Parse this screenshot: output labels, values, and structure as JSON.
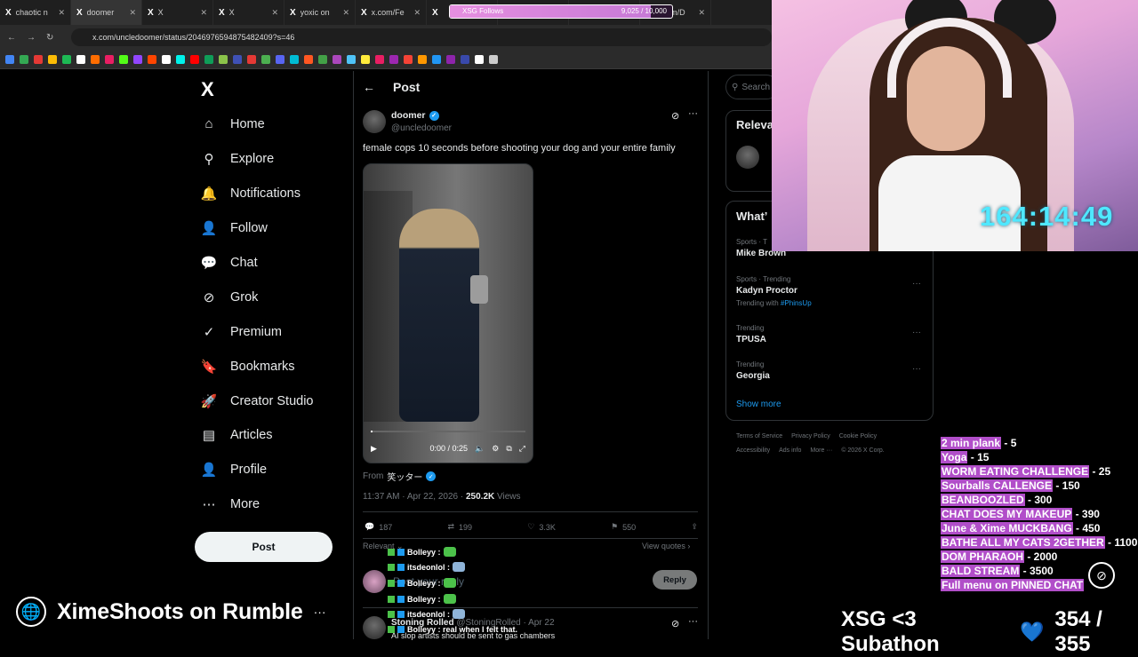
{
  "browser": {
    "tabs": [
      {
        "label": "chaotic n",
        "active": false
      },
      {
        "label": "doomer",
        "active": true
      },
      {
        "label": "X",
        "active": false
      },
      {
        "label": "X",
        "active": false
      },
      {
        "label": "yoxic on",
        "active": false
      },
      {
        "label": "x.com/Fe",
        "active": false
      },
      {
        "label": "",
        "active": false
      },
      {
        "label": "",
        "active": false
      },
      {
        "label": "",
        "active": false
      },
      {
        "label": "x.com/D",
        "active": false
      }
    ],
    "url": "x.com/uncledoomer/status/2046976594875482409?s=46",
    "follow_goal": {
      "label": "XSG Follows",
      "count": "9,025 / 10,000",
      "progress": 0.9025
    }
  },
  "sidebar": {
    "logo": "X",
    "items": [
      {
        "label": "Home",
        "icon": "home-icon",
        "glyph": "⌂"
      },
      {
        "label": "Explore",
        "icon": "search-icon",
        "glyph": "⚲"
      },
      {
        "label": "Notifications",
        "icon": "bell-icon",
        "glyph": "🔔"
      },
      {
        "label": "Follow",
        "icon": "person-plus-icon",
        "glyph": "👤"
      },
      {
        "label": "Chat",
        "icon": "chat-icon",
        "glyph": "💬"
      },
      {
        "label": "Grok",
        "icon": "grok-icon",
        "glyph": "⊘"
      },
      {
        "label": "Premium",
        "icon": "premium-icon",
        "glyph": "✓"
      },
      {
        "label": "Bookmarks",
        "icon": "bookmark-icon",
        "glyph": "🔖"
      },
      {
        "label": "Creator Studio",
        "icon": "rocket-icon",
        "glyph": "🚀"
      },
      {
        "label": "Articles",
        "icon": "articles-icon",
        "glyph": "▤"
      },
      {
        "label": "Profile",
        "icon": "profile-icon",
        "glyph": "👤"
      },
      {
        "label": "More",
        "icon": "more-icon",
        "glyph": "⋯"
      }
    ],
    "post_button": "Post"
  },
  "overlay_rumble": {
    "text": "XimeShoots on Rumble",
    "more": "···"
  },
  "post": {
    "header": "Post",
    "author": {
      "name": "doomer",
      "handle": "@uncledoomer"
    },
    "text": "female cops 10 seconds before shooting your dog and your entire family",
    "video": {
      "time": "0:00 / 0:25",
      "progress": 0.0
    },
    "from_label": "From",
    "from_name": "笑ッター",
    "timestamp": "11:37 AM · Apr 22, 2026 · ",
    "views_count": "250.2K",
    "views_label": " Views",
    "stats": {
      "replies": "187",
      "reposts": "199",
      "likes": "3.3K",
      "bookmarks": "550"
    },
    "relevant": "Relevant ⌄",
    "view_quotes": "View quotes ›",
    "reply_placeholder": "Post your reply",
    "reply_button": "Reply",
    "reply": {
      "name": "Stoning Rolled",
      "handle": "@StoningRolled · Apr 22",
      "text": "AI slop artists should be sent to gas chambers"
    }
  },
  "stream_chat": [
    {
      "user": "Bolleyy :",
      "emote_color": "#4cc24a"
    },
    {
      "user": "itsdeonlol :",
      "emote_color": "#8fb4d8"
    },
    {
      "user": "Bolleyy :",
      "emote_color": "#4cc24a"
    },
    {
      "user": "Bolleyy :",
      "emote_color": "#4cc24a"
    },
    {
      "user": "itsdeonlol :",
      "emote_color": "#8fb4d8"
    },
    {
      "user": "Bolleyy : real when I felt that.",
      "emote_color": ""
    }
  ],
  "right_panel": {
    "search": "Search",
    "relevant_title": "Releva",
    "whats_title": "What’",
    "trends": [
      {
        "cat": "Sports · T",
        "name": "Mike Brown",
        "sub": ""
      },
      {
        "cat": "Sports · Trending",
        "name": "Kadyn Proctor",
        "sub": "Trending with ",
        "tag": "#PhinsUp"
      },
      {
        "cat": "Trending",
        "name": "TPUSA",
        "sub": ""
      },
      {
        "cat": "Trending",
        "name": "Georgia",
        "sub": ""
      }
    ],
    "show_more": "Show more",
    "footer_row1": [
      "Terms of Service",
      "Privacy Policy",
      "Cookie Policy"
    ],
    "footer_row2": [
      "Accessibility",
      "Ads info",
      "More ···",
      "© 2026 X Corp."
    ]
  },
  "stream_overlay": {
    "timer": "164:14:49",
    "menu": [
      {
        "label": "2 min plank",
        "price": " - 5"
      },
      {
        "label": "Yoga",
        "price": " - 15"
      },
      {
        "label": "WORM EATING CHALLENGE",
        "price": " - 25"
      },
      {
        "label": "Sourballs CALLENGE",
        "price": " - 150"
      },
      {
        "label": "BEANBOOZLED",
        "price": " - 300"
      },
      {
        "label": "CHAT DOES MY MAKEUP",
        "price": " - 390"
      },
      {
        "label": "June & Xime MUCKBANG",
        "price": " - 450"
      },
      {
        "label": "BATHE ALL MY CATS 2GETHER",
        "price": " - 1100"
      },
      {
        "label": "DOM PHARAOH",
        "price": " - 2000"
      },
      {
        "label": "BALD STREAM",
        "price": " - 3500"
      },
      {
        "label": "Full menu on PINNED CHAT",
        "price": ""
      }
    ],
    "subathon": "XSG <3 Subathon",
    "heart": "💙",
    "sub_count": "354 / 355"
  },
  "colors": {
    "accent": "#1d9bf0",
    "timer": "#4fe8ff",
    "menu_highlight": "#b14ec9"
  }
}
